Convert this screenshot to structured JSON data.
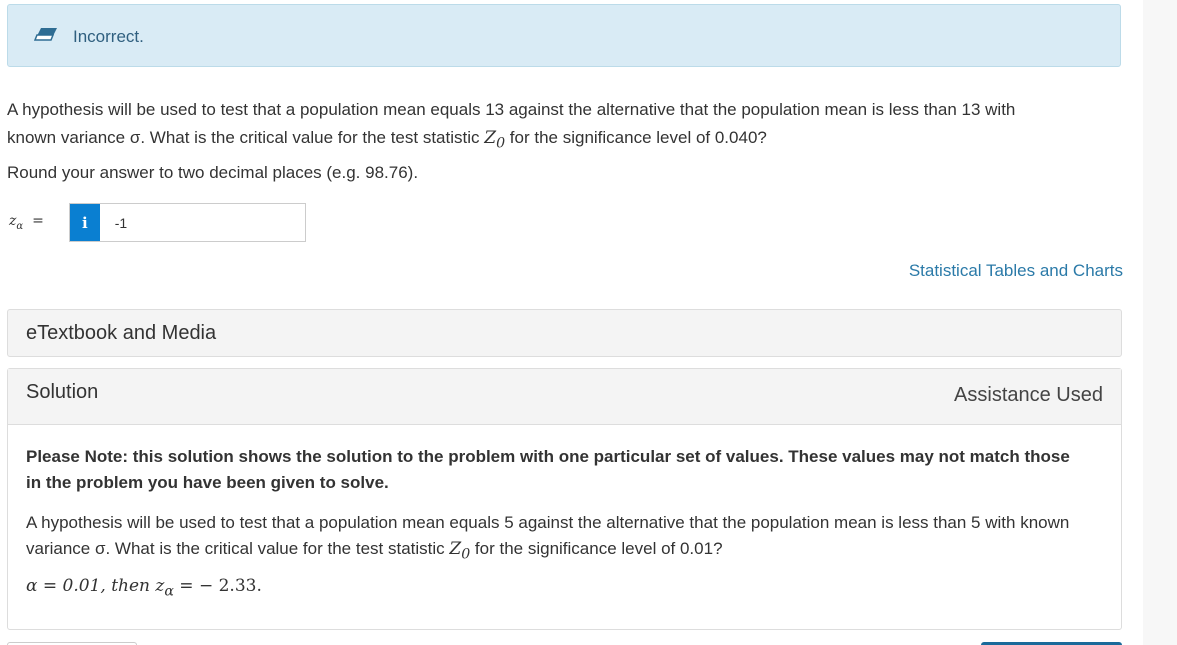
{
  "feedback": {
    "icon": "eraser-icon",
    "text": "Incorrect."
  },
  "question": {
    "line1": "A hypothesis will be used to test that a population mean equals 13 against the alternative that the population mean is less than 13 with",
    "line2_pre": "known variance σ. What is the critical value for the test statistic ",
    "z0_var": "Z",
    "z0_sub": "0",
    "line2_post": " for the significance level of 0.040?",
    "rounding": "Round your answer to two decimal places (e.g. 98.76)."
  },
  "answer": {
    "label_var": "z",
    "label_sub": "α",
    "equals": "=",
    "info_icon": "i",
    "value": "-1"
  },
  "links": {
    "stat_tables": "Statistical Tables and Charts"
  },
  "etextbook": {
    "label": "eTextbook and Media"
  },
  "solution": {
    "title": "Solution",
    "assistance": "Assistance Used",
    "note": "Please Note: this solution shows the solution to the problem with one particular set of values. These values may not match those in the problem you have been given to solve.",
    "body_pre": "A hypothesis will be used to test that a population mean equals 5 against the alternative that the population mean is less than 5 with known variance σ. What is the critical value for the test statistic ",
    "z0_var": "Z",
    "z0_sub": "0",
    "body_post": " for the significance level of 0.01?",
    "calc": "α = 0.01,  then z",
    "calc_sub": "α",
    "calc_result": " =   − 2.33."
  }
}
